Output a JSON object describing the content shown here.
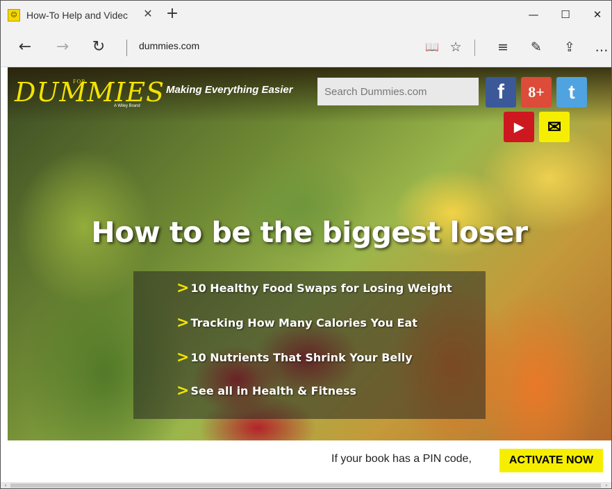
{
  "browser": {
    "tab_title": "How-To Help and Videc",
    "tab_close": "✕",
    "new_tab": "+",
    "minimize": "—",
    "maximize": "☐",
    "close": "✕",
    "address": "dummies.com",
    "icons": {
      "back": "←",
      "forward": "→",
      "refresh": "↻",
      "reading_view": "📖",
      "favorites": "☆",
      "hub": "≡",
      "web_note": "✎",
      "share": "⇪",
      "more": "…"
    }
  },
  "site": {
    "logo_for": "FOR",
    "logo_text": "DUMMIES",
    "logo_brand": "A Wiley Brand",
    "tagline": "Making Everything Easier",
    "search_placeholder": "Search Dummies.com",
    "social": {
      "facebook": "f",
      "googleplus": "8+",
      "twitter": "t",
      "youtube": "▶",
      "email": "✉"
    },
    "colors": {
      "brand_yellow": "#f3e300",
      "facebook": "#3b5998",
      "googleplus": "#dd4b39",
      "twitter": "#4fa3e0",
      "youtube": "#cc181e",
      "email": "#f6ee00"
    }
  },
  "hero": {
    "headline": "How to be the biggest loser",
    "links": [
      "10 Healthy Food Swaps for Losing Weight",
      "Tracking How Many Calories You Eat",
      "10 Nutrients That Shrink Your Belly",
      "See all in Health & Fitness"
    ]
  },
  "footer": {
    "pin_text": "If your book has a PIN code,",
    "activate": "ACTIVATE NOW"
  }
}
